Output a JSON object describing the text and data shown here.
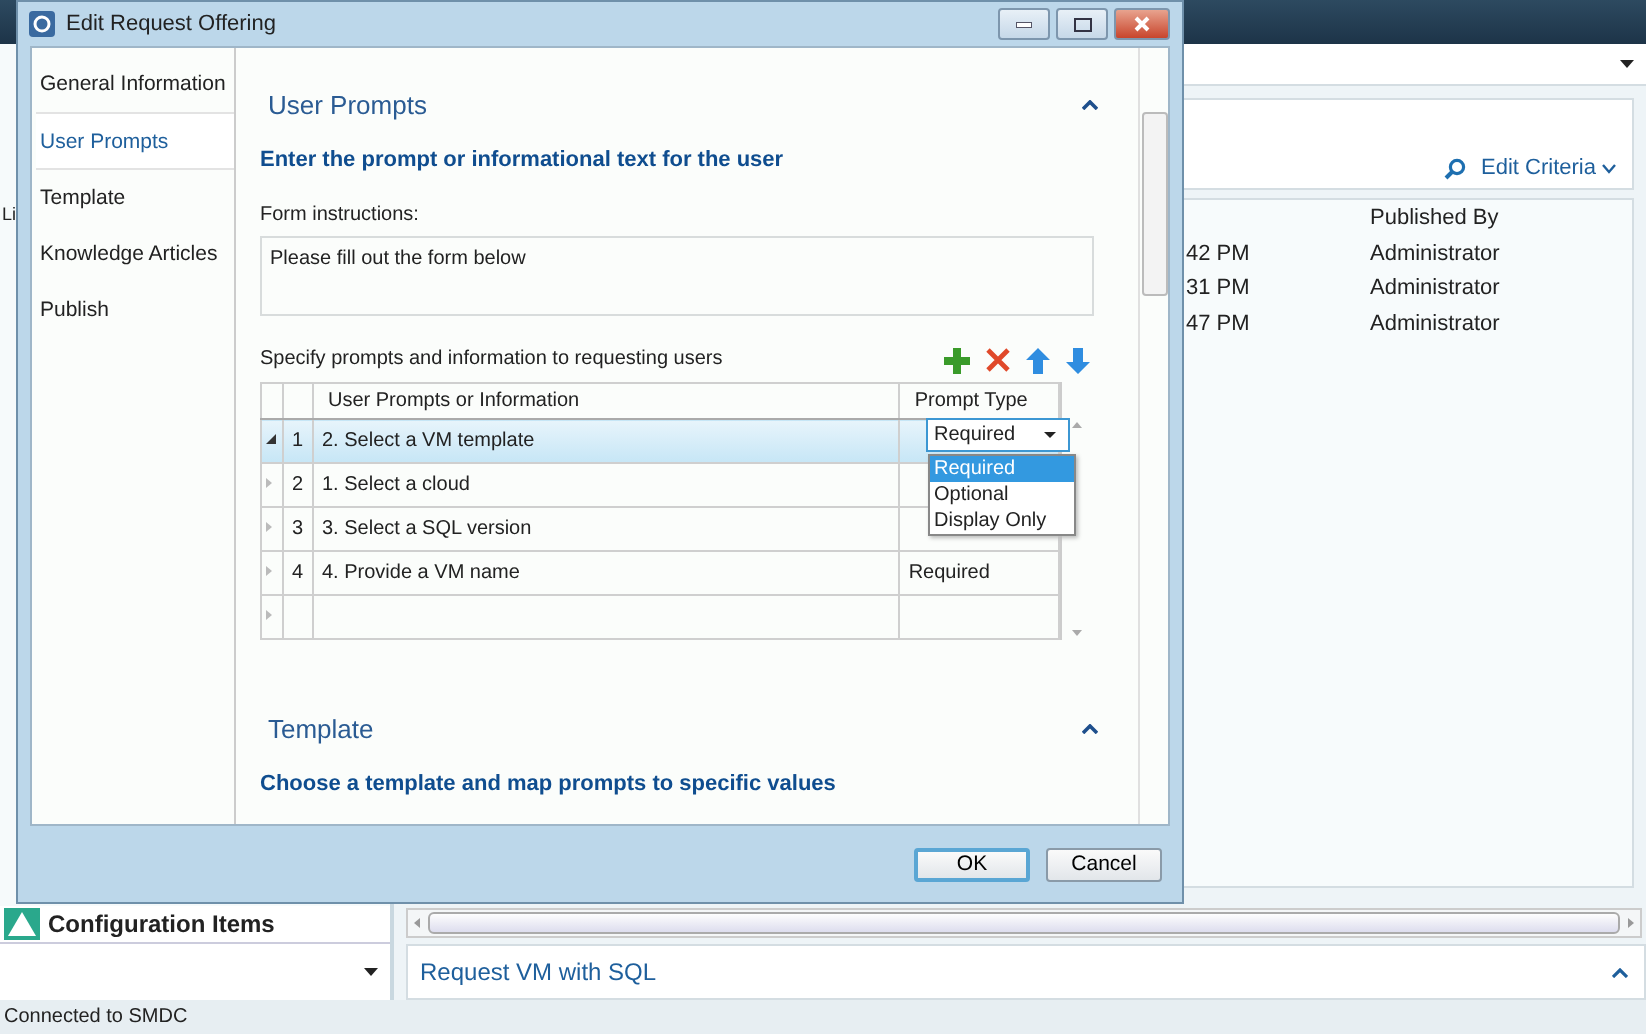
{
  "app": {
    "left_pane": {
      "partial_label": "Li",
      "navigation_item": "Configuration Items"
    },
    "search": {
      "link": "Edit Criteria"
    },
    "list": {
      "columns": [
        "Published By"
      ],
      "rows": [
        {
          "time": "42 PM",
          "published_by": "Administrator"
        },
        {
          "time": "31 PM",
          "published_by": "Administrator"
        },
        {
          "time": "47 PM",
          "published_by": "Administrator"
        }
      ]
    },
    "details": {
      "title": "Request VM with SQL"
    },
    "status_bar": "Connected to SMDC"
  },
  "dialog": {
    "title": "Edit Request Offering",
    "nav_items": [
      {
        "label": "General Information",
        "selected": false
      },
      {
        "label": "User Prompts",
        "selected": true
      },
      {
        "label": "Template",
        "selected": false
      },
      {
        "label": "Knowledge Articles",
        "selected": false
      },
      {
        "label": "Publish",
        "selected": false
      }
    ],
    "user_prompts": {
      "title": "User Prompts",
      "expanded": true,
      "heading": "Enter the prompt or informational text for the user",
      "form_instructions": {
        "label": "Form instructions:",
        "value": "Please fill out the form below"
      },
      "prompts_label": "Specify prompts and information to requesting users",
      "grid": {
        "columns": [
          "User Prompts or Information",
          "Prompt Type"
        ],
        "rows": [
          {
            "number": "1",
            "prompt": "2.  Select a VM template",
            "prompt_type": "Required",
            "selected": true
          },
          {
            "number": "2",
            "prompt": "1.  Select a cloud",
            "selected": false
          },
          {
            "number": "3",
            "prompt": "3.  Select a SQL version",
            "selected": false
          },
          {
            "number": "4",
            "prompt": "4.  Provide a VM name",
            "prompt_type": "Required",
            "selected": false
          }
        ],
        "dropdown_options": [
          {
            "label": "Required",
            "selected": true
          },
          {
            "label": "Optional",
            "selected": false
          },
          {
            "label": "Display Only",
            "selected": false
          }
        ]
      }
    },
    "template": {
      "title": "Template",
      "expanded": true,
      "heading": "Choose a template and map prompts to specific values"
    },
    "buttons": [
      {
        "label": "OK",
        "default": true
      },
      {
        "label": "Cancel",
        "default": false
      }
    ]
  }
}
